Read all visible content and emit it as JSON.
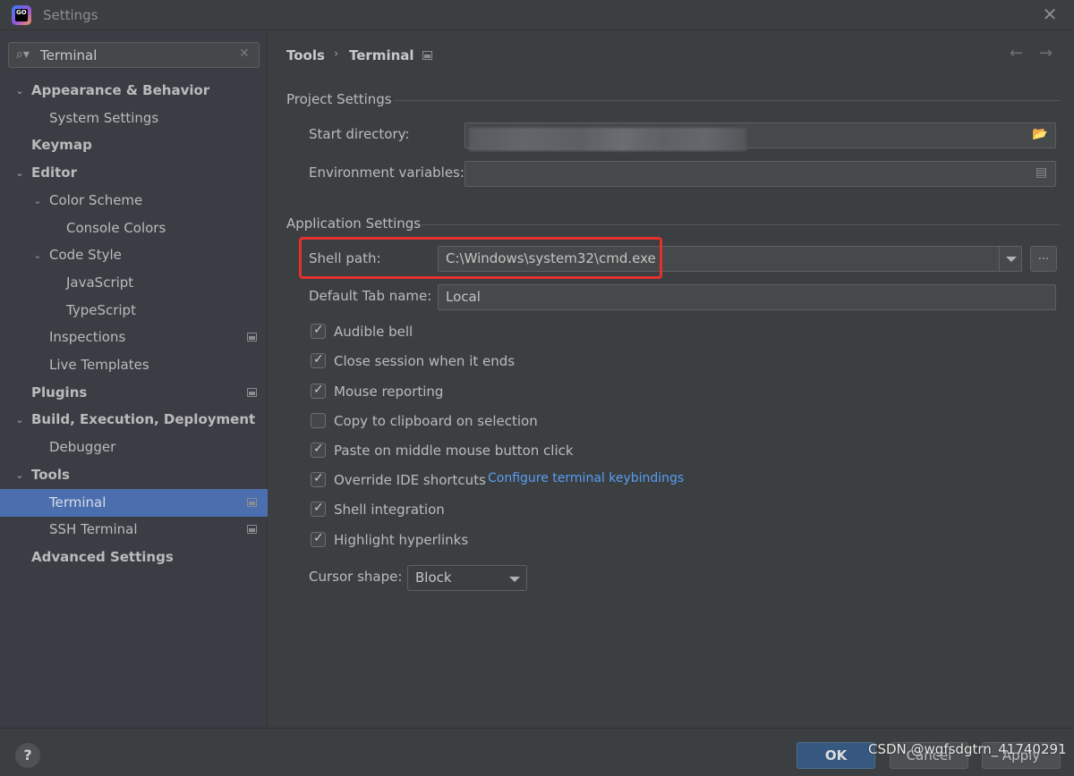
{
  "window": {
    "title": "Settings",
    "logo_text": "GO",
    "close_icon": "close-icon"
  },
  "sidebar": {
    "search": {
      "value": "Terminal",
      "placeholder": ""
    },
    "items": [
      {
        "label": "Appearance & Behavior",
        "level": 0,
        "bold": true,
        "expanded": true
      },
      {
        "label": "System Settings",
        "level": 1,
        "bold": false
      },
      {
        "label": "Keymap",
        "level": 0,
        "bold": true
      },
      {
        "label": "Editor",
        "level": 0,
        "bold": true,
        "expanded": true
      },
      {
        "label": "Color Scheme",
        "level": 1,
        "bold": false,
        "expanded": true
      },
      {
        "label": "Console Colors",
        "level": 2,
        "bold": false
      },
      {
        "label": "Code Style",
        "level": 1,
        "bold": false,
        "expanded": true
      },
      {
        "label": "JavaScript",
        "level": 2,
        "bold": false
      },
      {
        "label": "TypeScript",
        "level": 2,
        "bold": false
      },
      {
        "label": "Inspections",
        "level": 1,
        "bold": false,
        "project_icon": true
      },
      {
        "label": "Live Templates",
        "level": 1,
        "bold": false
      },
      {
        "label": "Plugins",
        "level": 0,
        "bold": true,
        "project_icon": true
      },
      {
        "label": "Build, Execution, Deployment",
        "level": 0,
        "bold": true,
        "expanded": true
      },
      {
        "label": "Debugger",
        "level": 1,
        "bold": false
      },
      {
        "label": "Tools",
        "level": 0,
        "bold": true,
        "expanded": true
      },
      {
        "label": "Terminal",
        "level": 1,
        "bold": false,
        "selected": true,
        "project_icon": true
      },
      {
        "label": "SSH Terminal",
        "level": 1,
        "bold": false,
        "project_icon": true
      },
      {
        "label": "Advanced Settings",
        "level": 0,
        "bold": true
      }
    ]
  },
  "breadcrumb": {
    "parent": "Tools",
    "separator": "›",
    "current": "Terminal",
    "back_icon": "←",
    "forward_icon": "→"
  },
  "project_settings": {
    "title": "Project Settings",
    "start_directory": {
      "label": "Start directory:",
      "value": ""
    },
    "environment_variables": {
      "label": "Environment variables:",
      "value": ""
    }
  },
  "application_settings": {
    "title": "Application Settings",
    "shell_path": {
      "label": "Shell path:",
      "value": "C:\\Windows\\system32\\cmd.exe",
      "browse_label": "..."
    },
    "default_tab_name": {
      "label": "Default Tab name:",
      "value": "Local"
    },
    "checkboxes": [
      {
        "label": "Audible bell",
        "checked": true
      },
      {
        "label": "Close session when it ends",
        "checked": true
      },
      {
        "label": "Mouse reporting",
        "checked": true
      },
      {
        "label": "Copy to clipboard on selection",
        "checked": false
      },
      {
        "label": "Paste on middle mouse button click",
        "checked": true
      },
      {
        "label": "Override IDE shortcuts",
        "checked": true
      },
      {
        "label": "Shell integration",
        "checked": true
      },
      {
        "label": "Highlight hyperlinks",
        "checked": true
      }
    ],
    "configure_link": "Configure terminal keybindings",
    "cursor_shape": {
      "label": "Cursor shape:",
      "value": "Block"
    }
  },
  "footer": {
    "help_label": "?",
    "ok_label": "OK",
    "cancel_label": "Cancel",
    "apply_label": "Apply"
  },
  "watermark": "CSDN @wgfsdgtrn_41740291",
  "colors": {
    "selection": "#4b6eaf",
    "link": "#589df6",
    "highlight_box": "#e4312d",
    "primary_button": "#365880"
  }
}
